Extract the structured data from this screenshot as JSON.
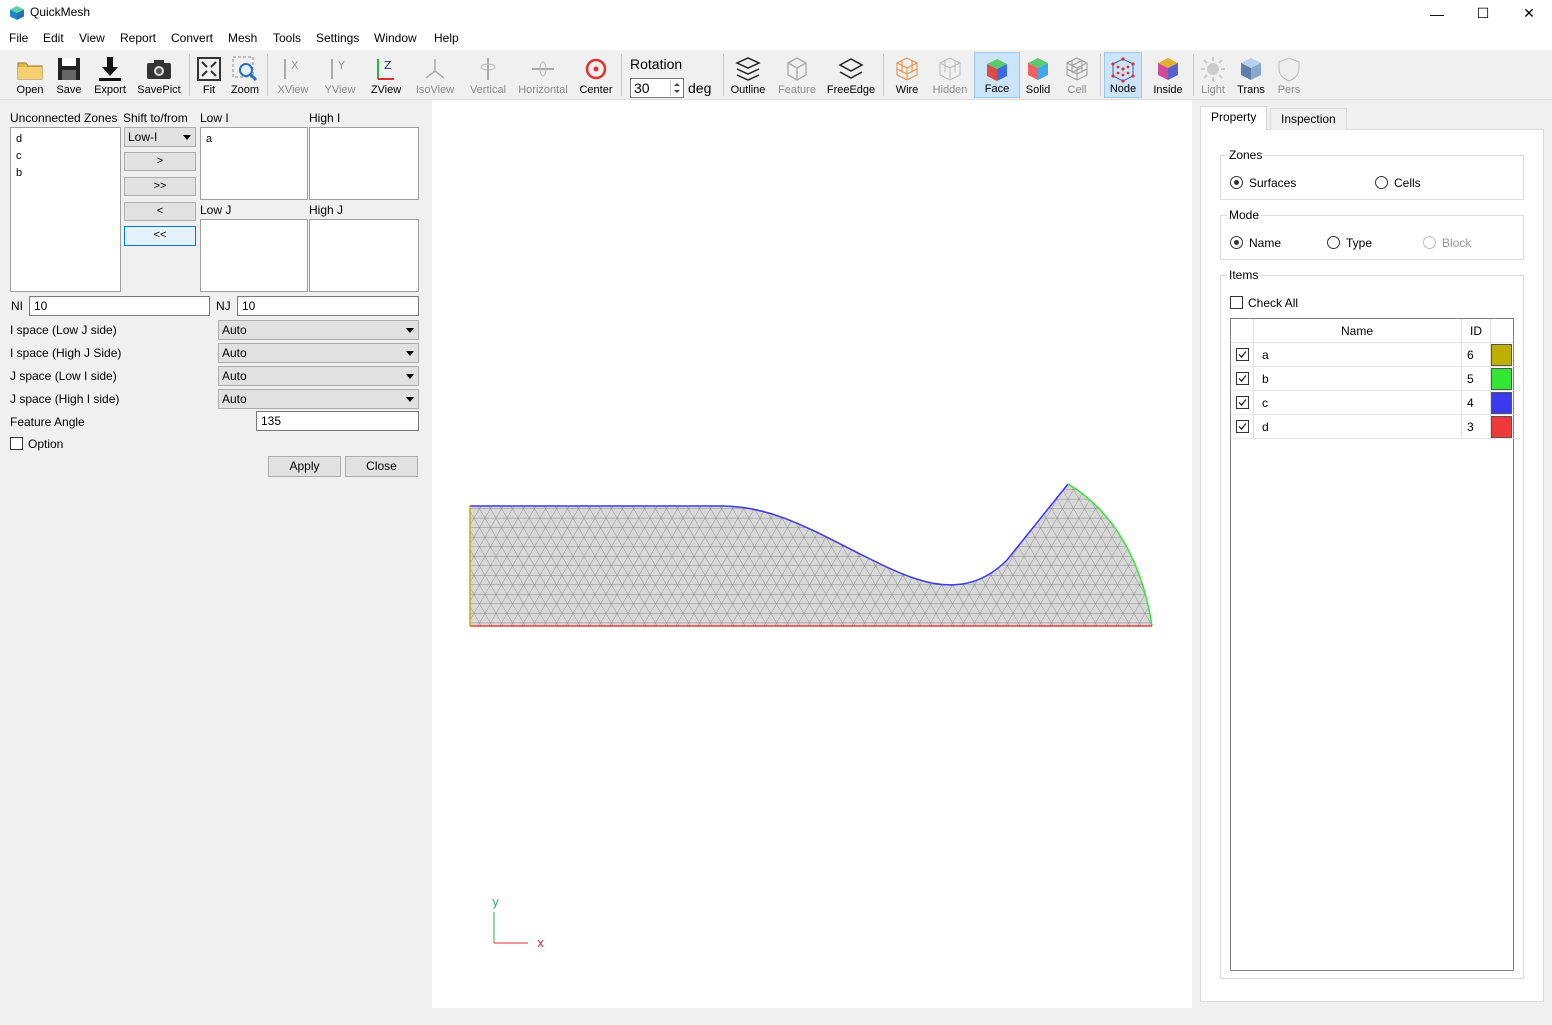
{
  "app": {
    "title": "QuickMesh"
  },
  "window_controls": {
    "minimize": "—",
    "maximize": "☐",
    "close": "✕"
  },
  "menu": [
    "File",
    "Edit",
    "View",
    "Report",
    "Convert",
    "Mesh",
    "Tools",
    "Settings",
    "Window",
    "Help"
  ],
  "toolbar": {
    "open": "Open",
    "save": "Save",
    "export": "Export",
    "savepict": "SavePict",
    "fit": "Fit",
    "zoom": "Zoom",
    "xview": "XView",
    "yview": "YView",
    "zview": "ZView",
    "isoview": "IsoView",
    "vertical": "Vertical",
    "horizontal": "Horizontal",
    "center": "Center",
    "rotation_label": "Rotation",
    "rotation_value": "30",
    "rotation_unit": "deg",
    "outline": "Outline",
    "feature": "Feature",
    "freeedge": "FreeEdge",
    "wire": "Wire",
    "hidden": "Hidden",
    "face": "Face",
    "solid": "Solid",
    "cell": "Cell",
    "node": "Node",
    "inside": "Inside",
    "light": "Light",
    "trans": "Trans",
    "pers": "Pers"
  },
  "left": {
    "unconnected_label": "Unconnected Zones",
    "shift_label": "Shift to/from",
    "unconnected_items": [
      "d",
      "c",
      "b"
    ],
    "shift_combo": "Low-I",
    "btn_right": ">",
    "btn_all_right": ">>",
    "btn_left": "<",
    "btn_all_left": "<<",
    "low_i_label": "Low I",
    "low_i_items": [
      "a"
    ],
    "high_i_label": "High I",
    "low_j_label": "Low J",
    "high_j_label": "High J",
    "ni_label": "NI",
    "ni_value": "10",
    "nj_label": "NJ",
    "nj_value": "10",
    "spaces": [
      {
        "label": "I space (Low J side)",
        "value": "Auto"
      },
      {
        "label": "I space (High J Side)",
        "value": "Auto"
      },
      {
        "label": "J space (Low I side)",
        "value": "Auto"
      },
      {
        "label": "J space (High I side)",
        "value": "Auto"
      }
    ],
    "feature_angle_label": "Feature Angle",
    "feature_angle_value": "135",
    "option_label": "Option",
    "apply": "Apply",
    "close": "Close"
  },
  "viewport": {
    "axis_y": "y",
    "axis_x": "x"
  },
  "right": {
    "tabs": [
      "Property",
      "Inspection"
    ],
    "zones_title": "Zones",
    "surfaces": "Surfaces",
    "cells": "Cells",
    "mode_title": "Mode",
    "name": "Name",
    "type": "Type",
    "block": "Block",
    "items_title": "Items",
    "check_all": "Check All",
    "col_name": "Name",
    "col_id": "ID",
    "rows": [
      {
        "name": "a",
        "id": "6",
        "color": "#bfb000"
      },
      {
        "name": "b",
        "id": "5",
        "color": "#33e633"
      },
      {
        "name": "c",
        "id": "4",
        "color": "#3a3aee"
      },
      {
        "name": "d",
        "id": "3",
        "color": "#f03a3a"
      }
    ]
  },
  "colors": {
    "zone_a": "#bfb000",
    "zone_b": "#33e633",
    "zone_c": "#3a3aee",
    "zone_d": "#f03a3a",
    "mesh": "#8a8a8a"
  }
}
